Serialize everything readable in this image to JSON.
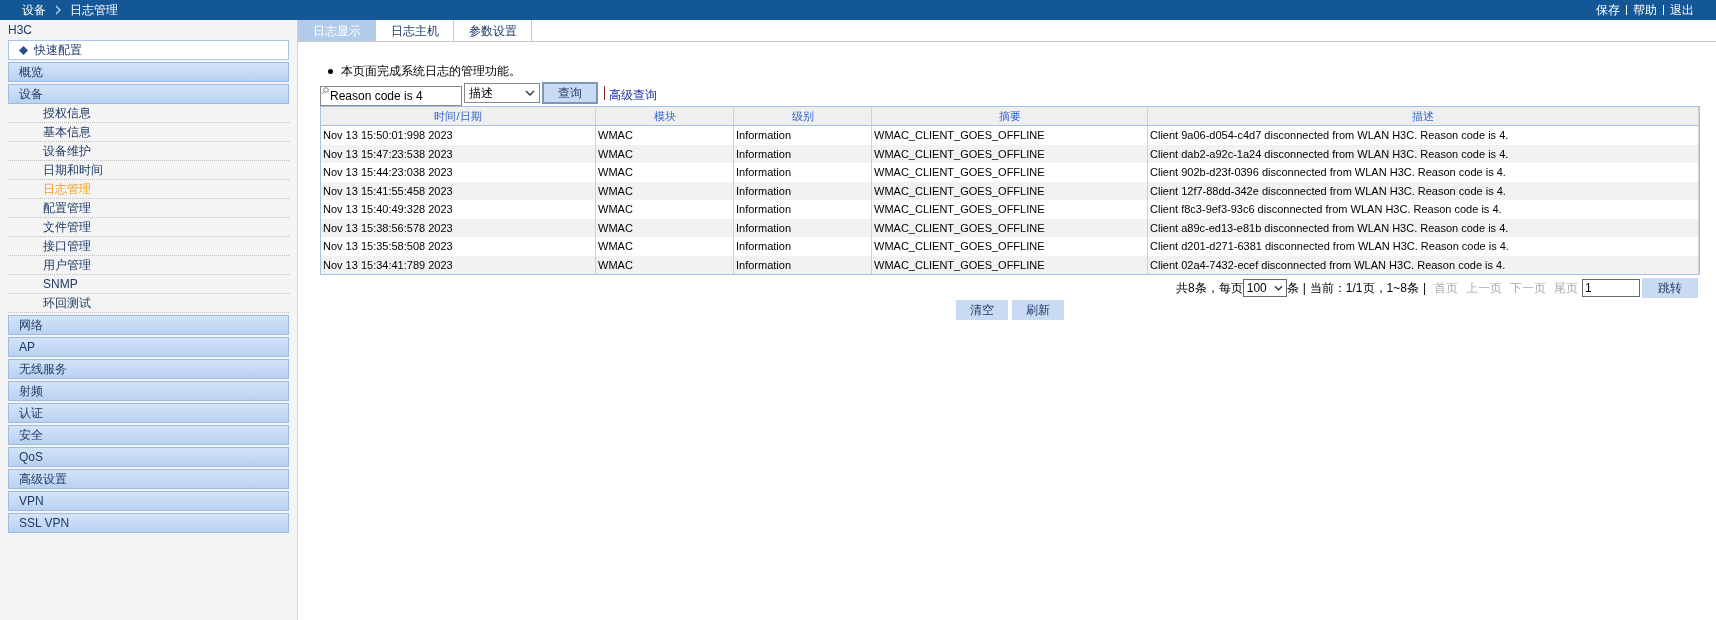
{
  "top_bar": {
    "breadcrumb": [
      "设备",
      "日志管理"
    ],
    "links": [
      "保存",
      "帮助",
      "退出"
    ]
  },
  "sidebar": {
    "title": "H3C",
    "quick": {
      "label": "快速配置"
    },
    "groups": [
      {
        "label": "概览"
      },
      {
        "label": "设备",
        "children": [
          {
            "label": "授权信息",
            "selected": false
          },
          {
            "label": "基本信息",
            "selected": false
          },
          {
            "label": "设备维护",
            "selected": false
          },
          {
            "label": "日期和时间",
            "selected": false
          },
          {
            "label": "日志管理",
            "selected": true
          },
          {
            "label": "配置管理",
            "selected": false
          },
          {
            "label": "文件管理",
            "selected": false
          },
          {
            "label": "接口管理",
            "selected": false
          },
          {
            "label": "用户管理",
            "selected": false
          },
          {
            "label": "SNMP",
            "selected": false
          },
          {
            "label": "环回测试",
            "selected": false
          }
        ]
      },
      {
        "label": "网络"
      },
      {
        "label": "AP"
      },
      {
        "label": "无线服务"
      },
      {
        "label": "射频"
      },
      {
        "label": "认证"
      },
      {
        "label": "安全"
      },
      {
        "label": "QoS"
      },
      {
        "label": "高级设置"
      },
      {
        "label": "VPN"
      },
      {
        "label": "SSL VPN"
      }
    ]
  },
  "tabs": [
    {
      "label": "日志显示",
      "selected": true
    },
    {
      "label": "日志主机",
      "selected": false
    },
    {
      "label": "参数设置",
      "selected": false
    }
  ],
  "intro": "本页面完成系统日志的管理功能。",
  "search": {
    "value": "Reason code is 4",
    "field": "描述",
    "button": "查询",
    "advanced": "高级查询"
  },
  "table": {
    "columns": [
      "时间/日期",
      "模块",
      "级别",
      "摘要",
      "描述"
    ],
    "rows": [
      [
        "Nov 13 15:50:01:998 2023",
        "WMAC",
        "Information",
        "WMAC_CLIENT_GOES_OFFLINE",
        "Client 9a06-d054-c4d7 disconnected from WLAN H3C. Reason code is 4."
      ],
      [
        "Nov 13 15:47:23:538 2023",
        "WMAC",
        "Information",
        "WMAC_CLIENT_GOES_OFFLINE",
        "Client dab2-a92c-1a24 disconnected from WLAN H3C. Reason code is 4."
      ],
      [
        "Nov 13 15:44:23:038 2023",
        "WMAC",
        "Information",
        "WMAC_CLIENT_GOES_OFFLINE",
        "Client 902b-d23f-0396 disconnected from WLAN H3C. Reason code is 4."
      ],
      [
        "Nov 13 15:41:55:458 2023",
        "WMAC",
        "Information",
        "WMAC_CLIENT_GOES_OFFLINE",
        "Client 12f7-88dd-342e disconnected from WLAN H3C. Reason code is 4."
      ],
      [
        "Nov 13 15:40:49:328 2023",
        "WMAC",
        "Information",
        "WMAC_CLIENT_GOES_OFFLINE",
        "Client f8c3-9ef3-93c6 disconnected from WLAN H3C. Reason code is 4."
      ],
      [
        "Nov 13 15:38:56:578 2023",
        "WMAC",
        "Information",
        "WMAC_CLIENT_GOES_OFFLINE",
        "Client a89c-ed13-e81b disconnected from WLAN H3C. Reason code is 4."
      ],
      [
        "Nov 13 15:35:58:508 2023",
        "WMAC",
        "Information",
        "WMAC_CLIENT_GOES_OFFLINE",
        "Client d201-d271-6381 disconnected from WLAN H3C. Reason code is 4."
      ],
      [
        "Nov 13 15:34:41:789 2023",
        "WMAC",
        "Information",
        "WMAC_CLIENT_GOES_OFFLINE",
        "Client 02a4-7432-ecef disconnected from WLAN H3C. Reason code is 4."
      ]
    ]
  },
  "pagination": {
    "total": "共8条，每页",
    "page_size": "100",
    "unit": "条",
    "separators": [
      "|",
      "|"
    ],
    "current": "当前：1/1页，1~8条",
    "links": [
      {
        "label": "首页",
        "disabled": true
      },
      {
        "label": "上一页",
        "disabled": true
      },
      {
        "label": "下一页",
        "disabled": true
      },
      {
        "label": "尾页",
        "disabled": true
      }
    ],
    "page_input": "1",
    "go": "跳转"
  },
  "actions": [
    "清空",
    "刷新"
  ]
}
